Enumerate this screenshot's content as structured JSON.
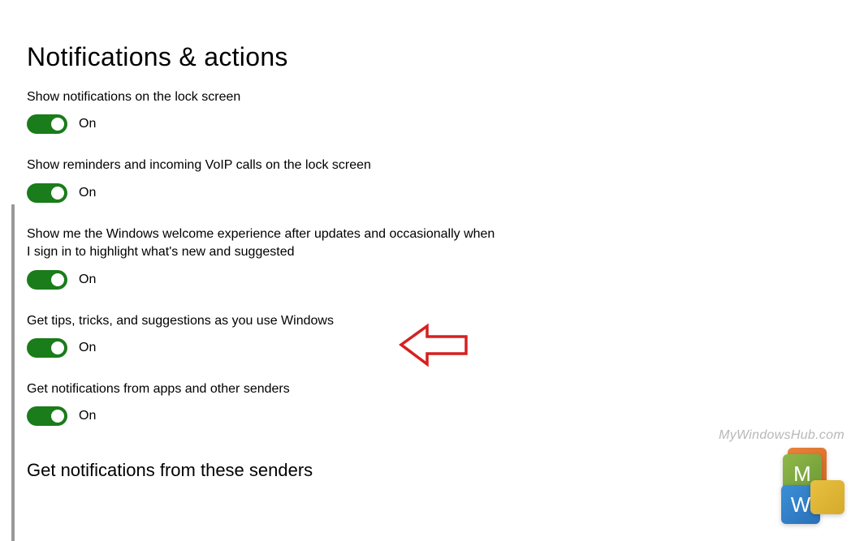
{
  "page_title": "Notifications & actions",
  "settings": [
    {
      "label": "Show notifications on the lock screen",
      "state": "On",
      "on": true
    },
    {
      "label": "Show reminders and incoming VoIP calls on the lock screen",
      "state": "On",
      "on": true
    },
    {
      "label": "Show me the Windows welcome experience after updates and occasionally when I sign in to highlight what's new and suggested",
      "state": "On",
      "on": true
    },
    {
      "label": "Get tips, tricks, and suggestions as you use Windows",
      "state": "On",
      "on": true
    },
    {
      "label": "Get notifications from apps and other senders",
      "state": "On",
      "on": true
    }
  ],
  "section_header": "Get notifications from these senders",
  "watermark_text": "MyWindowsHub.com",
  "logo_letters": {
    "m": "M",
    "w": "W"
  },
  "arrow_color": "#d62020"
}
